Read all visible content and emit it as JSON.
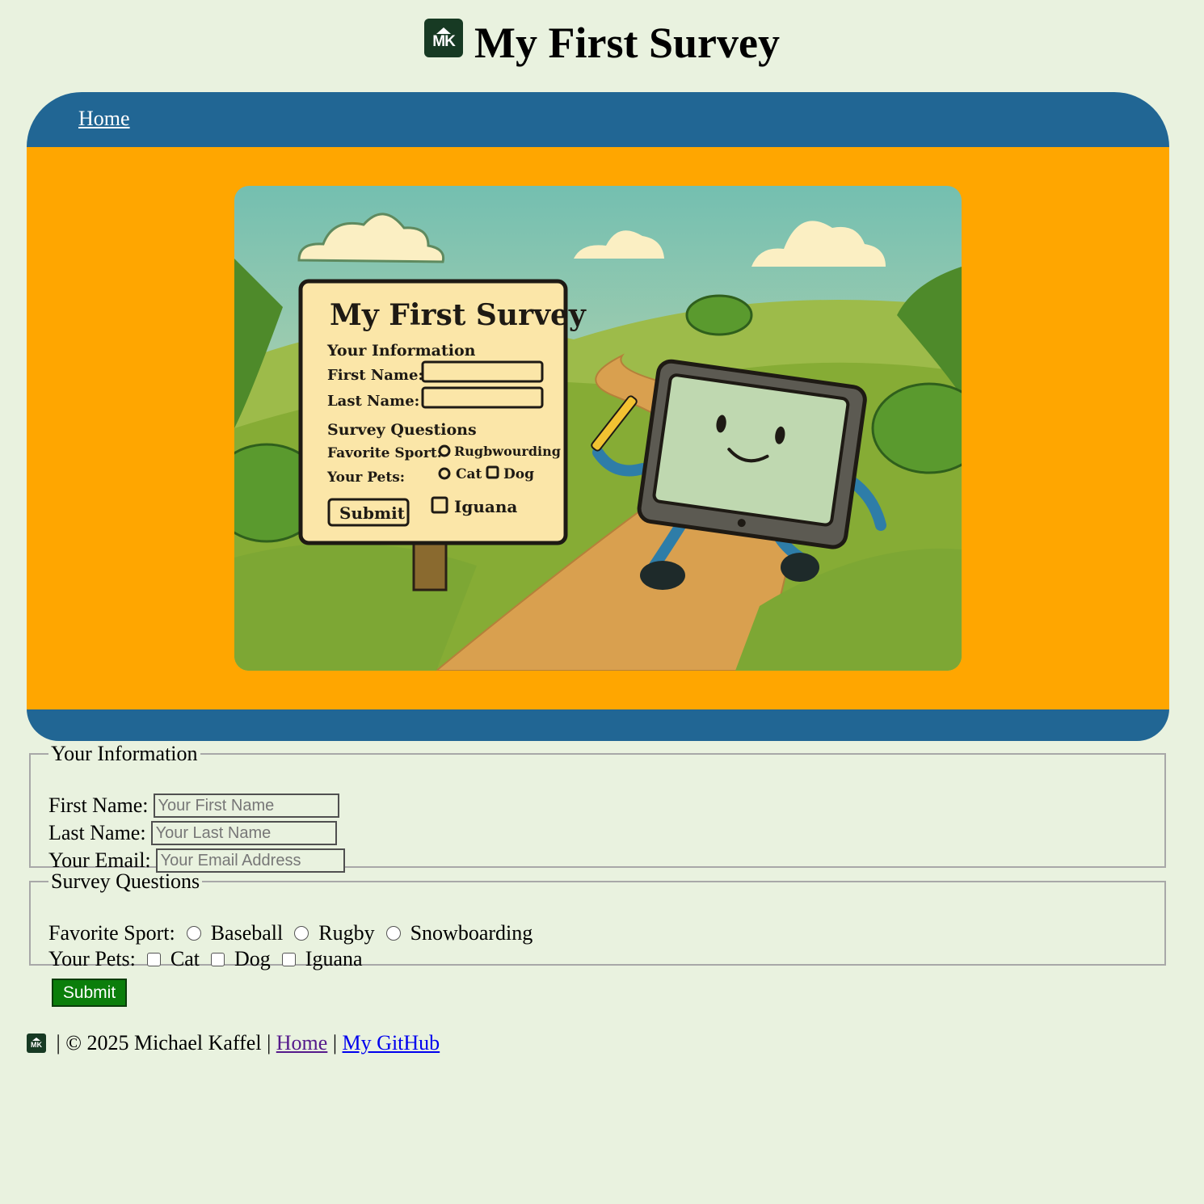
{
  "header": {
    "title": "My First Survey",
    "logo_text": "MK"
  },
  "nav": {
    "home_label": "Home"
  },
  "hero": {
    "sign_title": "My First Survey",
    "sign_info": "Your Information",
    "sign_first": "First Name:",
    "sign_last": "Last Name:",
    "sign_questions": "Survey Questions",
    "sign_sport": "Favorite Sport:",
    "sign_sport_opt": "Rugbwourding",
    "sign_pets": "Your Pets:",
    "sign_cat": "Cat",
    "sign_dog": "Dog",
    "sign_iguana": "Iguana",
    "sign_submit": "Submit"
  },
  "info": {
    "legend": "Your Information",
    "first_label": "First Name:",
    "first_placeholder": "Your First Name",
    "last_label": "Last Name:",
    "last_placeholder": "Your Last Name",
    "email_label": "Your Email:",
    "email_placeholder": "Your Email Address"
  },
  "survey": {
    "legend": "Survey Questions",
    "sport_label": "Favorite Sport:",
    "sports": [
      "Baseball",
      "Rugby",
      "Snowboarding"
    ],
    "pets_label": "Your Pets:",
    "pets": [
      "Cat",
      "Dog",
      "Iguana"
    ]
  },
  "submit_label": "Submit",
  "footer": {
    "copyright": " | © 2025 Michael Kaffel | ",
    "sep": " | ",
    "home_link": "Home",
    "github_link": "My GitHub"
  },
  "colors": {
    "background": "#e9f2df",
    "banner": "#216694",
    "banner_body": "#ffa600",
    "submit": "#0b7e0b"
  }
}
